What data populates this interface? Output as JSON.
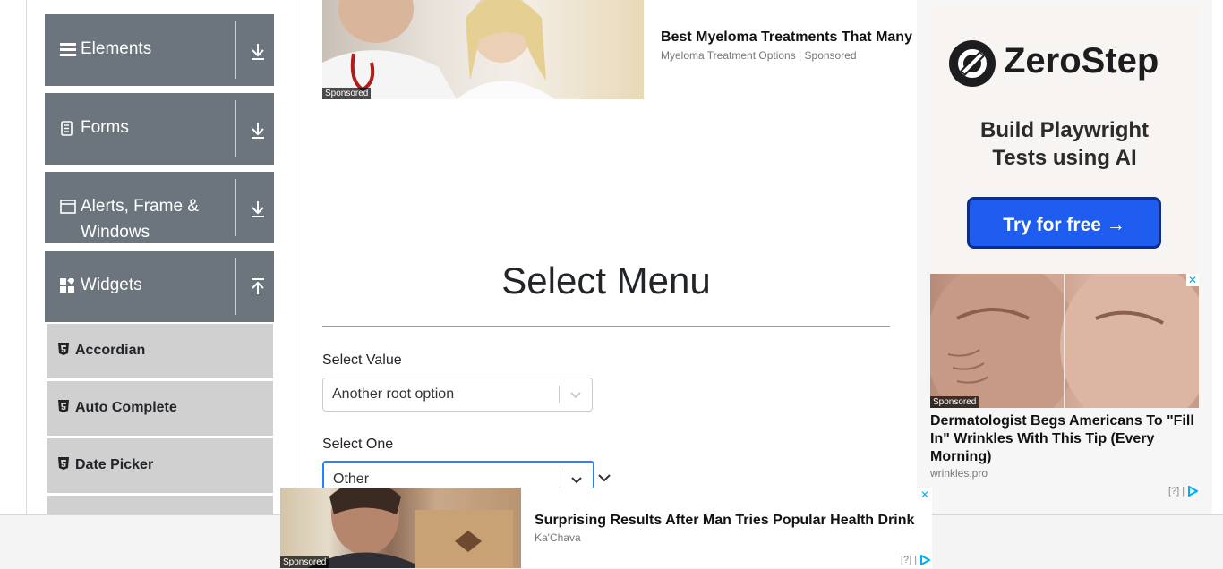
{
  "sidebar": {
    "groups": [
      {
        "title": "Elements",
        "icon": "hamburger-icon",
        "arrow": "download-arrow-icon"
      },
      {
        "title": "Forms",
        "icon": "document-icon",
        "arrow": "download-arrow-icon"
      },
      {
        "title": "Alerts, Frame &",
        "title_line2": "Windows",
        "icon": "window-icon",
        "arrow": "download-arrow-icon"
      },
      {
        "title": "Widgets",
        "icon": "widgets-icon",
        "arrow": "upload-arrow-icon"
      }
    ],
    "widget_items": [
      "Accordian",
      "Auto Complete",
      "Date Picker"
    ]
  },
  "top_ad": {
    "sponsored": "Sponsored",
    "headline": "Best Myeloma Treatments That Many",
    "source": "Myeloma Treatment Options | Sponsored"
  },
  "main": {
    "title": "Select Menu",
    "select_value": {
      "label": "Select Value",
      "value": "Another root option"
    },
    "select_one": {
      "label": "Select One",
      "value": "Other"
    }
  },
  "right_ads": {
    "zerostep": {
      "brand": "ZeroStep",
      "tagline_line1": "Build Playwright",
      "tagline_line2": "Tests using AI",
      "button": "Try for free →"
    },
    "wrinkles": {
      "sponsored": "Sponsored",
      "headline": "Dermatologist Begs Americans To \"Fill In\" Wrinkles With This Tip (Every Morning)",
      "source": "wrinkles.pro",
      "ad_choices": "[?] |"
    }
  },
  "bottom_ad": {
    "sponsored": "Sponsored",
    "headline": "Surprising Results After Man Tries Popular Health Drink",
    "source": "Ka'Chava",
    "ad_choices": "[?] |"
  },
  "colors": {
    "sidebar_group": "#6c757d",
    "sidebar_subitem": "#d0d0d0",
    "focus_border": "#2684ff",
    "zerostep_button": "#1f5cf0"
  }
}
